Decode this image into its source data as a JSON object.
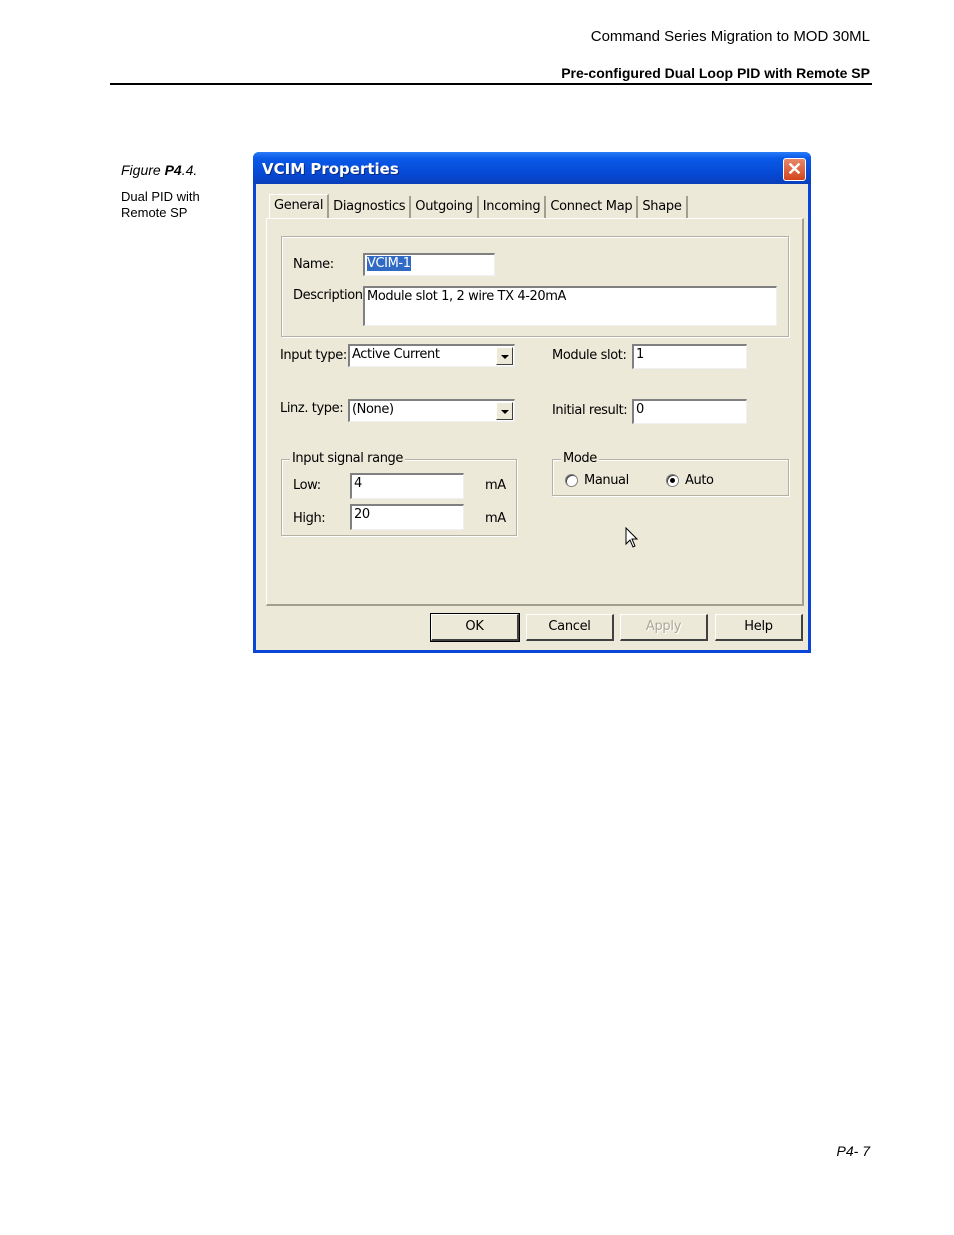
{
  "page": {
    "header_title": "Command Series Migration to MOD 30ML",
    "header_subtitle": "Pre-configured Dual Loop PID with Remote SP",
    "figure_label_prefix": "Figure ",
    "figure_label_bold": "P4",
    "figure_label_suffix": ".4.",
    "figure_description": "Dual PID with Remote SP",
    "page_number": "P4- 7"
  },
  "dialog": {
    "title": "VCIM Properties",
    "close_glyph": "✕",
    "tabs": [
      {
        "label": "General",
        "active": true
      },
      {
        "label": "Diagnostics",
        "active": false
      },
      {
        "label": "Outgoing",
        "active": false
      },
      {
        "label": "Incoming",
        "active": false
      },
      {
        "label": "Connect Map",
        "active": false
      },
      {
        "label": "Shape",
        "active": false
      }
    ],
    "name_label": "Name:",
    "name_value": "VCIM-1",
    "description_label": "Description:",
    "description_value": "Module slot 1, 2 wire TX 4-20mA",
    "input_type_label": "Input type:",
    "input_type_value": "Active Current",
    "linz_type_label": "Linz. type:",
    "linz_type_value": "(None)",
    "module_slot_label": "Module slot:",
    "module_slot_value": "1",
    "initial_result_label": "Initial result:",
    "initial_result_value": "0",
    "signal_range": {
      "title": "Input signal range",
      "low_label": "Low:",
      "low_value": "4",
      "low_unit": "mA",
      "high_label": "High:",
      "high_value": "20",
      "high_unit": "mA"
    },
    "mode": {
      "title": "Mode",
      "options": [
        {
          "label": "Manual",
          "checked": false
        },
        {
          "label": "Auto",
          "checked": true
        }
      ]
    },
    "buttons": {
      "ok": "OK",
      "cancel": "Cancel",
      "apply": "Apply",
      "help": "Help"
    }
  }
}
